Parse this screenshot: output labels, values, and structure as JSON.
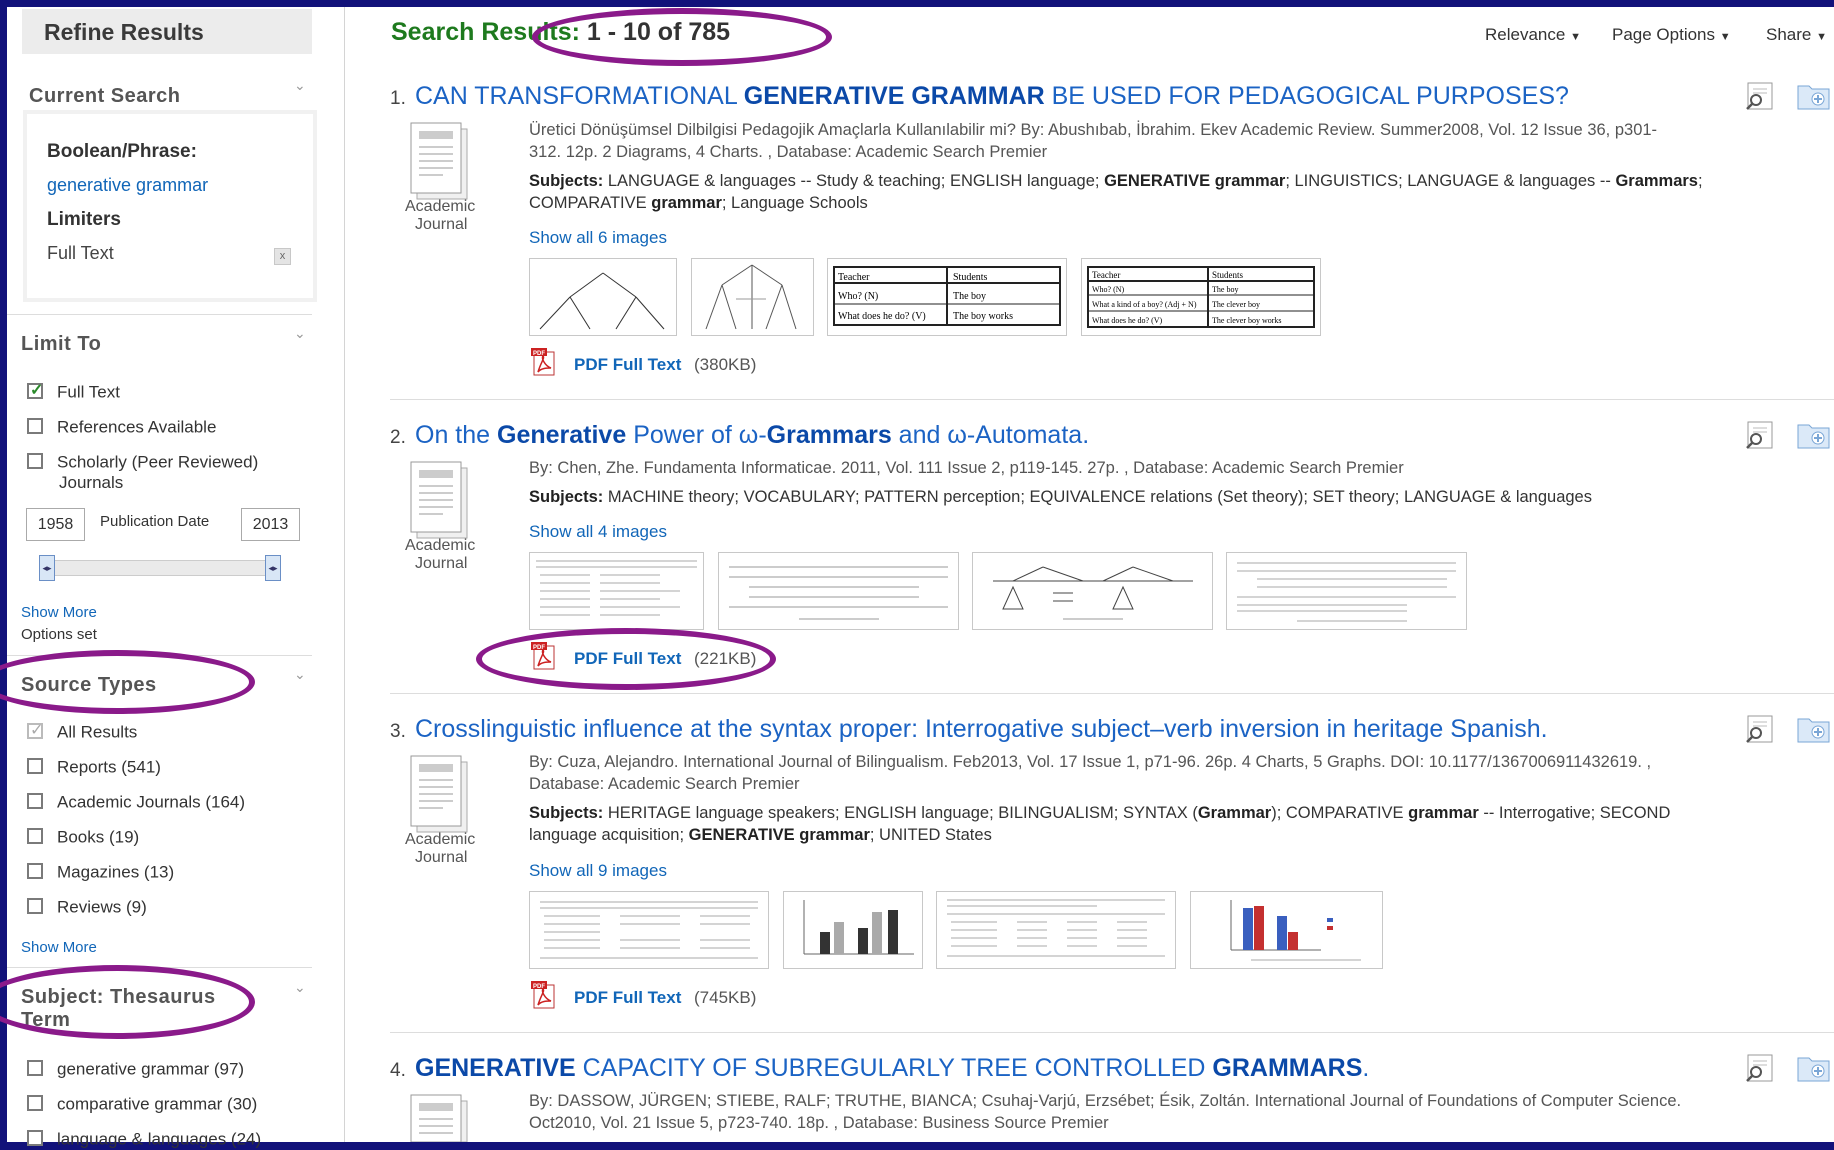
{
  "sidebar": {
    "refine_title": "Refine Results",
    "current_search": {
      "title": "Current Search",
      "boolean_label": "Boolean/Phrase:",
      "boolean_value": "generative grammar",
      "limiters_label": "Limiters",
      "limiter_value": "Full Text",
      "remove": "x"
    },
    "limit_to": {
      "title": "Limit To",
      "items": [
        {
          "label": "Full Text",
          "checked": true
        },
        {
          "label": "References Available",
          "checked": false
        },
        {
          "label": "Scholarly (Peer Reviewed)",
          "label2": "Journals",
          "checked": false
        }
      ],
      "date_from": "1958",
      "date_label": "Publication Date",
      "date_to": "2013",
      "show_more": "Show More",
      "options_set": "Options set"
    },
    "source_types": {
      "title": "Source Types",
      "items": [
        {
          "label": "All Results"
        },
        {
          "label": "Reports (541)"
        },
        {
          "label": "Academic Journals (164)"
        },
        {
          "label": "Books (19)"
        },
        {
          "label": "Magazines (13)"
        },
        {
          "label": "Reviews (9)"
        }
      ],
      "show_more": "Show More"
    },
    "subject": {
      "title_line1": "Subject: Thesaurus",
      "title_line2": "Term",
      "items": [
        {
          "label": "generative grammar (97)"
        },
        {
          "label": "comparative grammar (30)"
        },
        {
          "label": "language & languages (24)"
        }
      ]
    }
  },
  "header": {
    "title_prefix": "Search Results:",
    "title_range": "1 - 10 of 785",
    "relevance": "Relevance",
    "page_options": "Page Options",
    "share": "Share"
  },
  "results": [
    {
      "num": "1.",
      "title_parts": [
        "CAN TRANSFORMATIONAL ",
        "GENERATIVE GRAMMAR",
        " BE USED FOR PEDAGOGICAL PURPOSES?"
      ],
      "type_line1": "Academic",
      "type_line2": "Journal",
      "meta_line1": "Üretici Dönüşümsel Dilbilgisi Pedagojik Amaçlarla Kullanılabilir mi? By: Abushıbab, İbrahim. Ekev Academic Review. Summer2008, Vol. 12 Issue 36, p301-",
      "meta_line2": "312. 12p. 2 Diagrams, 4 Charts. , Database: Academic Search Premier",
      "subjects_label": "Subjects:",
      "subjects_a": " LANGUAGE & languages -- Study & teaching; ENGLISH language; ",
      "subjects_b": "GENERATIVE grammar",
      "subjects_c": "; LINGUISTICS; LANGUAGE & languages -- ",
      "subjects_d": "Grammars",
      "subjects_e": ";",
      "subjects_line2a": "COMPARATIVE ",
      "subjects_line2b": "grammar",
      "subjects_line2c": "; Language Schools",
      "show_all": "Show all 6 images",
      "pdf_label": "PDF Full Text",
      "pdf_size": "(380KB)",
      "table_headers": [
        "Teacher",
        "Students"
      ],
      "table1_rows": [
        [
          "Who? (N)",
          "The boy"
        ],
        [
          "What does he do? (V)",
          "The boy works"
        ]
      ],
      "table2_rows": [
        [
          "Who? (N)",
          "The boy"
        ],
        [
          "What a kind of a boy? (Adj + N)",
          "The clever boy"
        ],
        [
          "What does he do? (V)",
          "The clever boy works"
        ]
      ]
    },
    {
      "num": "2.",
      "title_parts": [
        "On the ",
        "Generative",
        " Power of ω-",
        "Grammars",
        " and ω-Automata."
      ],
      "type_line1": "Academic",
      "type_line2": "Journal",
      "meta_line1": "By: Chen, Zhe. Fundamenta Informaticae. 2011, Vol. 111 Issue 2, p119-145. 27p. , Database: Academic Search Premier",
      "subjects_label": "Subjects:",
      "subjects_a": " MACHINE theory; VOCABULARY; PATTERN perception; EQUIVALENCE relations (Set theory); SET theory; LANGUAGE & languages",
      "show_all": "Show all 4 images",
      "pdf_label": "PDF Full Text",
      "pdf_size": "(221KB)"
    },
    {
      "num": "3.",
      "title": "Crosslinguistic influence at the syntax proper: Interrogative subject–verb inversion in heritage Spanish.",
      "type_line1": "Academic",
      "type_line2": "Journal",
      "meta_line1": "By: Cuza, Alejandro. International Journal of Bilingualism. Feb2013, Vol. 17 Issue 1, p71-96. 26p. 4 Charts, 5 Graphs. DOI: 10.1177/1367006911432619. ,",
      "meta_line2": "Database: Academic Search Premier",
      "subjects_label": "Subjects:",
      "subjects_a": " HERITAGE language speakers; ENGLISH language; BILINGUALISM; SYNTAX (",
      "subjects_b": "Grammar",
      "subjects_c": "); COMPARATIVE ",
      "subjects_d": "grammar",
      "subjects_e": " -- Interrogative; SECOND",
      "subjects_line2a": "language acquisition; ",
      "subjects_line2b": "GENERATIVE grammar",
      "subjects_line2c": "; UNITED States",
      "show_all": "Show all 9 images",
      "pdf_label": "PDF Full Text",
      "pdf_size": "(745KB)"
    },
    {
      "num": "4.",
      "title_parts": [
        "GENERATIVE",
        " CAPACITY OF SUBREGULARLY TREE CONTROLLED ",
        "GRAMMARS",
        "."
      ],
      "meta_line1": "By: DASSOW, JÜRGEN; STIEBE, RALF; TRUTHE, BIANCA; Csuhaj-Varjú, Erzsébet; Ésik, Zoltán. International Journal of Foundations of Computer Science.",
      "meta_line2": "Oct2010, Vol. 21 Issue 5, p723-740. 18p. , Database: Business Source Premier"
    }
  ],
  "colors": {
    "frame": "#12127a",
    "title_green": "#1e7a1e",
    "link_blue": "#1166b8",
    "annotation": "#8a1a8a"
  }
}
